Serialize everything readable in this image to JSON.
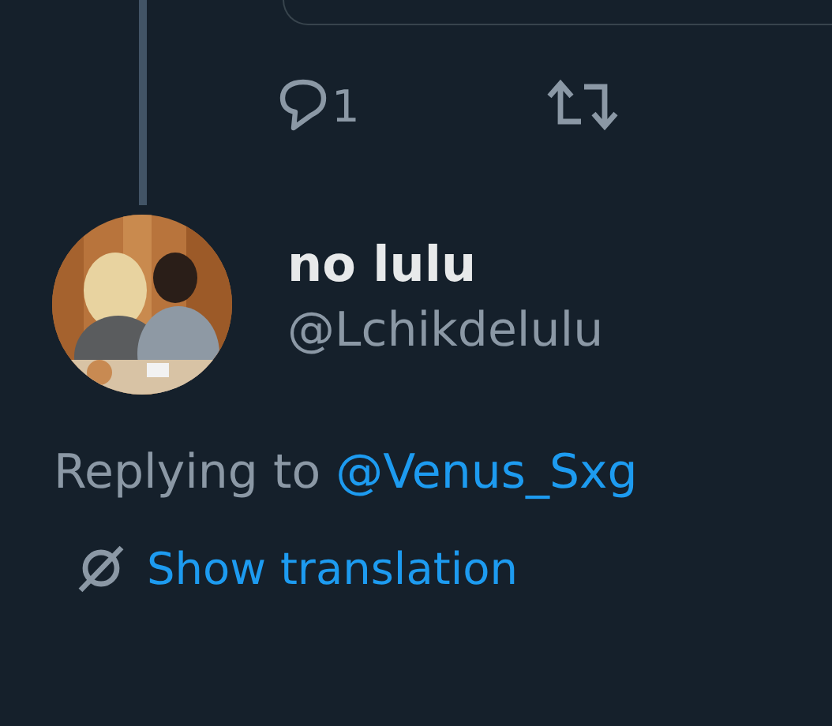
{
  "quoted_tweet": {
    "kind": "card"
  },
  "actions": {
    "reply_count": "1"
  },
  "reply": {
    "display_name": "no lulu",
    "handle": "@Lchikdelulu",
    "replying_prefix": "Replying to ",
    "replying_to": "@Venus_Sxg",
    "translate_label": "Show translation"
  }
}
